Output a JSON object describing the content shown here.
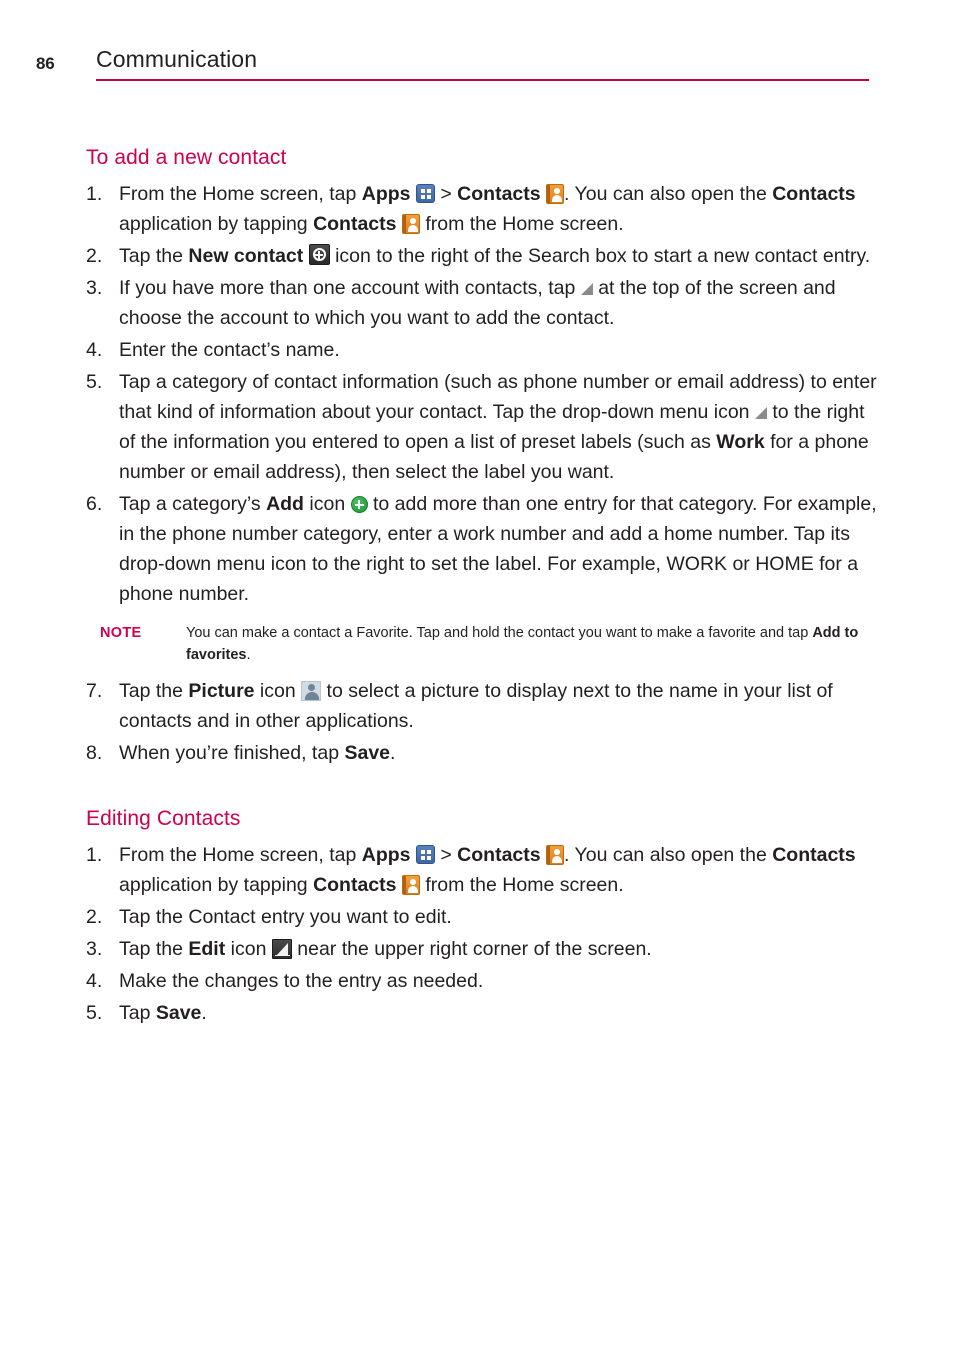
{
  "header": {
    "page_number": "86",
    "title": "Communication",
    "rule_color": "#c10050"
  },
  "colors": {
    "heading": "#d0004f",
    "note_label": "#d0004f",
    "body_text": "#231f20"
  },
  "sections": [
    {
      "heading": "To add a new contact",
      "steps": [
        {
          "num": "1.",
          "parts": [
            {
              "t": "text",
              "v": "From the Home screen, tap "
            },
            {
              "t": "bold",
              "v": "Apps"
            },
            {
              "t": "text",
              "v": " "
            },
            {
              "t": "icon",
              "v": "apps-icon"
            },
            {
              "t": "text",
              "v": " > "
            },
            {
              "t": "bold",
              "v": "Contacts"
            },
            {
              "t": "text",
              "v": " "
            },
            {
              "t": "icon",
              "v": "contacts-icon"
            },
            {
              "t": "text",
              "v": ". You can also open the "
            },
            {
              "t": "bold",
              "v": "Contacts"
            },
            {
              "t": "text",
              "v": " application by tapping "
            },
            {
              "t": "bold",
              "v": "Contacts"
            },
            {
              "t": "text",
              "v": " "
            },
            {
              "t": "icon",
              "v": "contacts-icon"
            },
            {
              "t": "text",
              "v": " from the Home screen."
            }
          ]
        },
        {
          "num": "2.",
          "parts": [
            {
              "t": "text",
              "v": "Tap the "
            },
            {
              "t": "bold",
              "v": "New contact"
            },
            {
              "t": "text",
              "v": " "
            },
            {
              "t": "icon",
              "v": "new-contact-icon"
            },
            {
              "t": "text",
              "v": " icon to the right of the Search box to start a new contact entry."
            }
          ]
        },
        {
          "num": "3.",
          "parts": [
            {
              "t": "text",
              "v": "If you have more than one account with contacts, tap "
            },
            {
              "t": "icon",
              "v": "dropdown-menu-icon"
            },
            {
              "t": "text",
              "v": " at the top of the screen and choose the account to which you want to add the contact."
            }
          ]
        },
        {
          "num": "4.",
          "parts": [
            {
              "t": "text",
              "v": "Enter the contact’s name."
            }
          ]
        },
        {
          "num": "5.",
          "parts": [
            {
              "t": "text",
              "v": "Tap a category of contact information (such as phone number or email address) to enter that kind of information about your contact. Tap the drop-down menu icon "
            },
            {
              "t": "icon",
              "v": "dropdown-menu-icon"
            },
            {
              "t": "text",
              "v": " to the right of the information you entered to open a list of preset labels (such as "
            },
            {
              "t": "bold",
              "v": "Work"
            },
            {
              "t": "text",
              "v": " for a phone number or email address), then select the label you want."
            }
          ]
        },
        {
          "num": "6.",
          "parts": [
            {
              "t": "text",
              "v": "Tap a category’s "
            },
            {
              "t": "bold",
              "v": "Add"
            },
            {
              "t": "text",
              "v": " icon "
            },
            {
              "t": "icon",
              "v": "add-icon"
            },
            {
              "t": "text",
              "v": " to add more than one entry for that category. For example, in the phone number category, enter a work number and add a home number. Tap its drop-down menu icon to the right to set the label. For example, WORK or HOME for a phone number."
            }
          ]
        }
      ],
      "note": {
        "label": "NOTE",
        "parts": [
          {
            "t": "text",
            "v": "You can make a contact a Favorite. Tap and hold the contact you want to make a favorite and tap "
          },
          {
            "t": "bold",
            "v": "Add to favorites"
          },
          {
            "t": "text",
            "v": "."
          }
        ]
      },
      "steps_after_note": [
        {
          "num": "7.",
          "parts": [
            {
              "t": "text",
              "v": "Tap the "
            },
            {
              "t": "bold",
              "v": "Picture"
            },
            {
              "t": "text",
              "v": " icon "
            },
            {
              "t": "icon",
              "v": "picture-icon"
            },
            {
              "t": "text",
              "v": " to select a picture to display next to the name in your list of contacts and in other applications."
            }
          ]
        },
        {
          "num": "8.",
          "parts": [
            {
              "t": "text",
              "v": "When you’re finished, tap "
            },
            {
              "t": "bold",
              "v": "Save"
            },
            {
              "t": "text",
              "v": "."
            }
          ]
        }
      ]
    },
    {
      "heading": "Editing Contacts",
      "steps": [
        {
          "num": "1.",
          "parts": [
            {
              "t": "text",
              "v": "From the Home screen, tap "
            },
            {
              "t": "bold",
              "v": "Apps"
            },
            {
              "t": "text",
              "v": " "
            },
            {
              "t": "icon",
              "v": "apps-icon"
            },
            {
              "t": "text",
              "v": " > "
            },
            {
              "t": "bold",
              "v": "Contacts"
            },
            {
              "t": "text",
              "v": " "
            },
            {
              "t": "icon",
              "v": "contacts-icon"
            },
            {
              "t": "text",
              "v": ". You can also open the "
            },
            {
              "t": "bold",
              "v": "Contacts"
            },
            {
              "t": "text",
              "v": " application by tapping "
            },
            {
              "t": "bold",
              "v": "Contacts"
            },
            {
              "t": "text",
              "v": " "
            },
            {
              "t": "icon",
              "v": "contacts-icon"
            },
            {
              "t": "text",
              "v": " from the Home screen."
            }
          ]
        },
        {
          "num": "2.",
          "parts": [
            {
              "t": "text",
              "v": "Tap the Contact entry you want to edit."
            }
          ]
        },
        {
          "num": "3.",
          "parts": [
            {
              "t": "text",
              "v": "Tap the "
            },
            {
              "t": "bold",
              "v": "Edit"
            },
            {
              "t": "text",
              "v": " icon "
            },
            {
              "t": "icon",
              "v": "edit-icon"
            },
            {
              "t": "text",
              "v": " near the upper right corner of the screen."
            }
          ]
        },
        {
          "num": "4.",
          "parts": [
            {
              "t": "text",
              "v": "Make the changes to the entry as needed."
            }
          ]
        },
        {
          "num": "5.",
          "parts": [
            {
              "t": "text",
              "v": "Tap "
            },
            {
              "t": "bold",
              "v": "Save"
            },
            {
              "t": "text",
              "v": "."
            }
          ]
        }
      ]
    }
  ]
}
